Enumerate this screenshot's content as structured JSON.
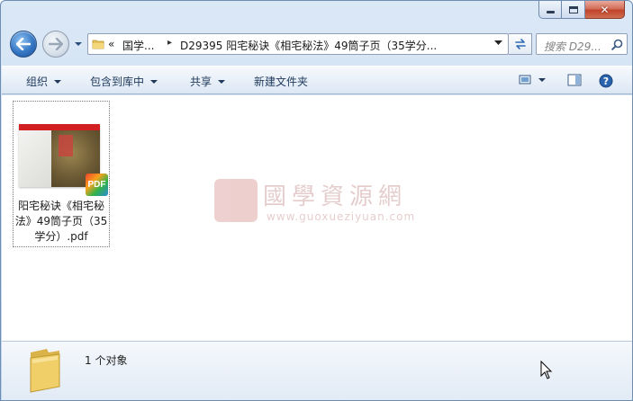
{
  "window": {
    "min_icon": "minimize-icon",
    "max_icon": "maximize-icon",
    "close_icon": "close-icon"
  },
  "nav": {
    "back_icon": "back-arrow-icon",
    "forward_icon": "forward-arrow-icon",
    "address": {
      "chevrons": "«",
      "crumb1": "国学...",
      "crumb_separator": "▸",
      "crumb2": "D29395 阳宅秘诀《相宅秘法》49筒子页（35学分..."
    },
    "search_placeholder": "搜索 D29..."
  },
  "toolbar": {
    "organize": "组织",
    "include_in_library": "包含到库中",
    "share": "共享",
    "new_folder": "新建文件夹"
  },
  "files": [
    {
      "name": "阳宅秘诀《相宅秘法》49筒子页（35学分）.pdf",
      "badge": "PDF"
    }
  ],
  "watermark": {
    "title": "國學資源網",
    "url": "www.guoxueziyuan.com"
  },
  "status": {
    "count_text": "1 个对象"
  },
  "colors": {
    "accent": "#3577c4",
    "toolbar_text": "#1e395b",
    "close_red": "#c0432a"
  }
}
